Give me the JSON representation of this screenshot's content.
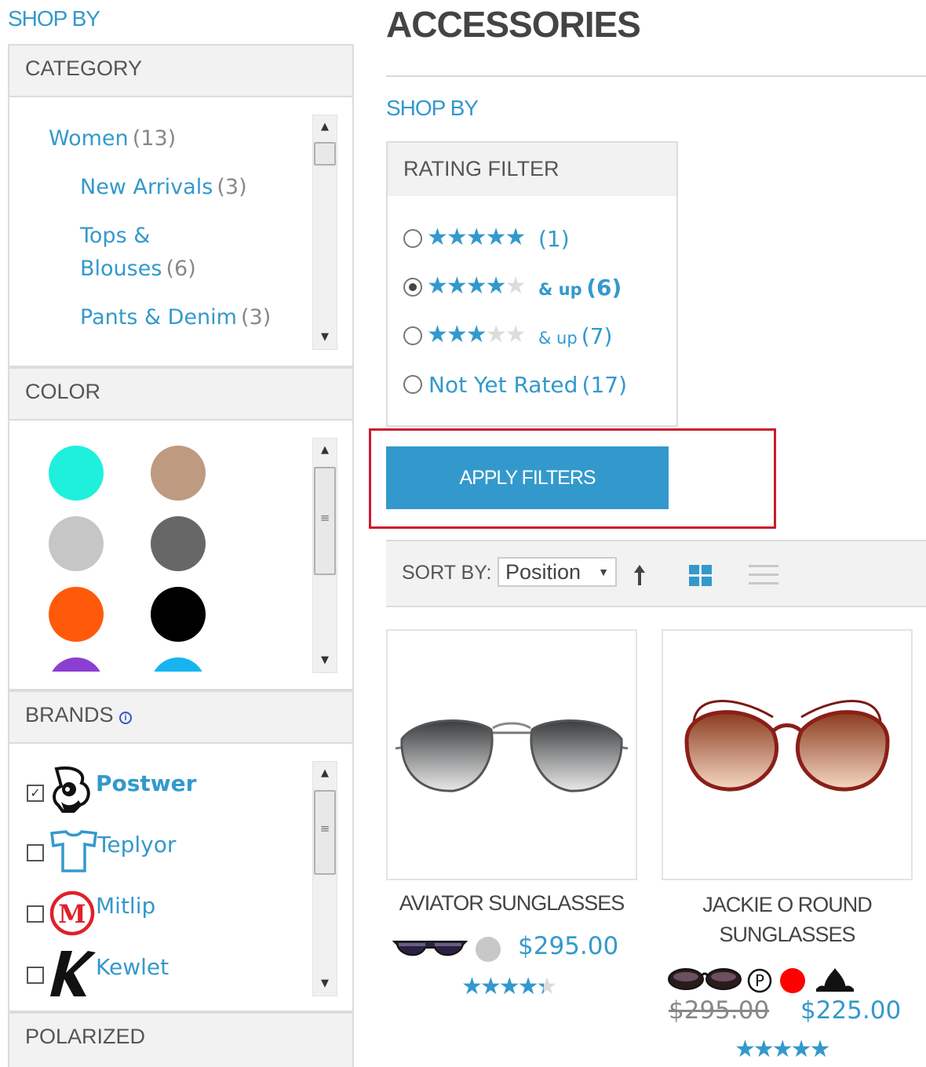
{
  "sidebar": {
    "title": "SHOP BY",
    "category": {
      "heading": "CATEGORY",
      "items": [
        {
          "label": "Women",
          "count": "(13)"
        },
        {
          "label": "New Arrivals",
          "count": "(3)"
        },
        {
          "label_line1": "Tops &",
          "label_line2": "Blouses",
          "count": "(6)"
        },
        {
          "label": "Pants & Denim",
          "count": "(3)"
        }
      ]
    },
    "color": {
      "heading": "COLOR",
      "swatches": [
        "#1ef0dc",
        "#bd9a80",
        "#c6c6c6",
        "#676767",
        "#ff5a0a",
        "#000000",
        "#8a3fd2",
        "#16b5f0"
      ]
    },
    "brands": {
      "heading": "BRANDS",
      "info_icon": "info-icon",
      "items": [
        {
          "name": "Postwer",
          "checked": true,
          "logo": "panda-logo-icon"
        },
        {
          "name": "Teplyor",
          "checked": false,
          "logo": "shirt-logo-icon"
        },
        {
          "name": "Mitlip",
          "checked": false,
          "logo": "m-circle-logo-icon"
        },
        {
          "name": "Kewlet",
          "checked": false,
          "logo": "k-logo-icon"
        }
      ]
    },
    "polarized": {
      "heading": "POLARIZED"
    }
  },
  "main": {
    "title": "ACCESSORIES",
    "shop_by": "SHOP BY",
    "rating_filter": {
      "heading": "RATING FILTER",
      "options": [
        {
          "stars": 5,
          "suffix": "",
          "count": "(1)",
          "selected": false
        },
        {
          "stars": 4,
          "suffix": "& up",
          "count": "(6)",
          "selected": true
        },
        {
          "stars": 3,
          "suffix": "& up",
          "count": "(7)",
          "selected": false
        },
        {
          "stars": 0,
          "label": "Not Yet Rated",
          "count": "(17)",
          "selected": false
        }
      ]
    },
    "apply_button": "APPLY FILTERS",
    "toolbar": {
      "sort_label": "SORT BY:",
      "sort_value": "Position",
      "sort_direction_icon": "arrow-up-icon",
      "grid_icon": "grid-view-icon",
      "list_icon": "list-view-icon"
    },
    "products": [
      {
        "name": "AVIATOR SUNGLASSES",
        "price": "$295.00",
        "rating": 4.5,
        "swatch": "#c8c8c8"
      },
      {
        "name_line1": "JACKIE O ROUND",
        "name_line2": "SUNGLASSES",
        "old_price": "$295.00",
        "price": "$225.00",
        "rating": 5,
        "swatch": "#ff0000"
      }
    ]
  }
}
